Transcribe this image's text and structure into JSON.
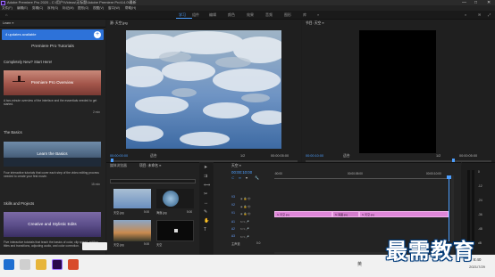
{
  "window": {
    "title": "Adobe Premiere Pro 2020 - C:\\用户\\Videos\\无标题\\Adobe Premiere Pro\\14.0\\最新",
    "minimize": "—",
    "maximize": "□",
    "close": "✕"
  },
  "menu": [
    "文件(F)",
    "编辑(E)",
    "剪辑(C)",
    "序列(S)",
    "标记(M)",
    "图形(G)",
    "视图(V)",
    "窗口(W)",
    "帮助(H)"
  ],
  "workspace_tabs": [
    "学习",
    "组件",
    "编辑",
    "颜色",
    "效果",
    "音频",
    "图形",
    "库",
    "»"
  ],
  "learn": {
    "panel_tab": "Learn ≡",
    "updates_label": "4 updates available",
    "panel_title": "Premiere Pro Tutorials",
    "sections": [
      {
        "heading": "Completely New? Start Here!",
        "tutorial_title": "Premiere Pro Overview",
        "description": "A two-minute overview of the interface and the essentials needed to get started.",
        "duration": "2 min"
      },
      {
        "heading": "The Basics",
        "tutorial_title": "Learn the Basics",
        "description": "Four interactive tutorials that cover each step of the video editing process needed to create your first movie.",
        "duration": "15 min"
      },
      {
        "heading": "Skills and Projects",
        "tutorial_title": "Creative and Stylistic Edits",
        "description": "Five interactive tutorials that teach the basics of color, clip speed, adding titles and transitions, adjusting audio, and color correction.",
        "duration": ""
      }
    ]
  },
  "source_monitor": {
    "tab": "源: 天空.jpg",
    "timecode_in": "00:00:00:00",
    "fit": "适合",
    "timecode_out": "00:00:05:00",
    "zoom": "1/2",
    "wrench": "🔧"
  },
  "program_monitor": {
    "tab": "节目: 天空 ≡",
    "timecode_in": "00:00:10:00",
    "fit": "适合",
    "timecode_out": "00:00:05:00",
    "zoom": "1/2"
  },
  "project": {
    "tabs": [
      "媒体浏览器",
      "项目: 未命名 ≡"
    ],
    "items": [
      {
        "label": "天空.jpg",
        "duration": "5:00"
      },
      {
        "label": "海面.jpg",
        "duration": "5:00"
      },
      {
        "label": "天空.jpg",
        "duration": "5:00"
      },
      {
        "label": "天空",
        "duration": ""
      }
    ]
  },
  "timeline": {
    "tab": "天空 ≡",
    "timecode": "00:00:10:00",
    "ruler_marks": [
      ":00:00",
      "00:00:05:00",
      "00:00:10:00"
    ],
    "tracks": [
      "V3",
      "V2",
      "V1",
      "A1",
      "A2",
      "A3",
      "主声道"
    ],
    "master_value": "0.0",
    "clips": [
      {
        "label": "fx 天空.jpg"
      },
      {
        "label": "fx 海面.jpg"
      },
      {
        "label": "fx 天空.jpg"
      }
    ]
  },
  "meters": {
    "scale": [
      "0",
      "-12",
      "-24",
      "-36",
      "-48",
      "dB"
    ],
    "labels": [
      "S",
      "S"
    ]
  },
  "taskbar": {
    "time": "8:40",
    "date": "2021/7/29",
    "lang": "英"
  },
  "watermark": "最需教育",
  "colors": {
    "accent_blue": "#2d72d9",
    "timecode_blue": "#4d9fff",
    "clip_pink": "#df87d9",
    "panel_bg": "#232323"
  }
}
